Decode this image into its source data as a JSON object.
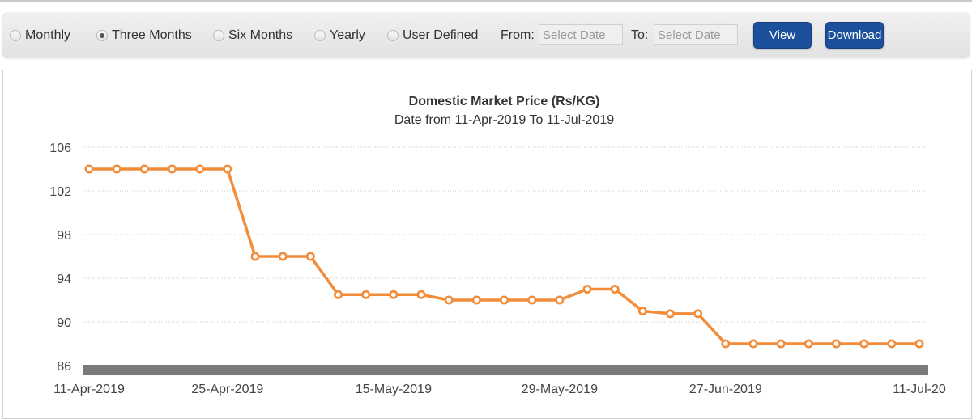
{
  "toolbar": {
    "range_options": [
      {
        "label": "Monthly",
        "checked": false
      },
      {
        "label": "Three Months",
        "checked": true
      },
      {
        "label": "Six Months",
        "checked": false
      },
      {
        "label": "Yearly",
        "checked": false
      },
      {
        "label": "User Defined",
        "checked": false
      }
    ],
    "from_label": "From:",
    "from_placeholder": "Select Date",
    "to_label": "To:",
    "to_placeholder": "Select Date",
    "view_label": "View",
    "download_label": "Download"
  },
  "colors": {
    "line": "#f28c38",
    "button": "#1c4f9c",
    "axis_bar": "#7a7a7a"
  },
  "chart_data": {
    "type": "line",
    "title": "Domestic Market Price (Rs/KG)",
    "subtitle": "Date from 11-Apr-2019 To 11-Jul-2019",
    "xlabel": "",
    "ylabel": "",
    "ylim": [
      86,
      106
    ],
    "yticks": [
      106,
      102,
      98,
      94,
      90,
      86
    ],
    "xtick_labels": [
      "11-Apr-2019",
      "25-Apr-2019",
      "15-May-2019",
      "29-May-2019",
      "27-Jun-2019",
      "11-Jul-20"
    ],
    "xtick_indices": [
      0,
      5,
      11,
      17,
      23,
      30
    ],
    "grid": true,
    "legend": "none",
    "series": [
      {
        "name": "Domestic Market Price",
        "values": [
          104,
          104,
          104,
          104,
          104,
          104,
          96,
          96,
          96,
          92.5,
          92.5,
          92.5,
          92.5,
          92,
          92,
          92,
          92,
          92,
          93,
          93,
          91,
          90.75,
          90.75,
          88,
          88,
          88,
          88,
          88,
          88,
          88,
          88
        ]
      }
    ]
  }
}
